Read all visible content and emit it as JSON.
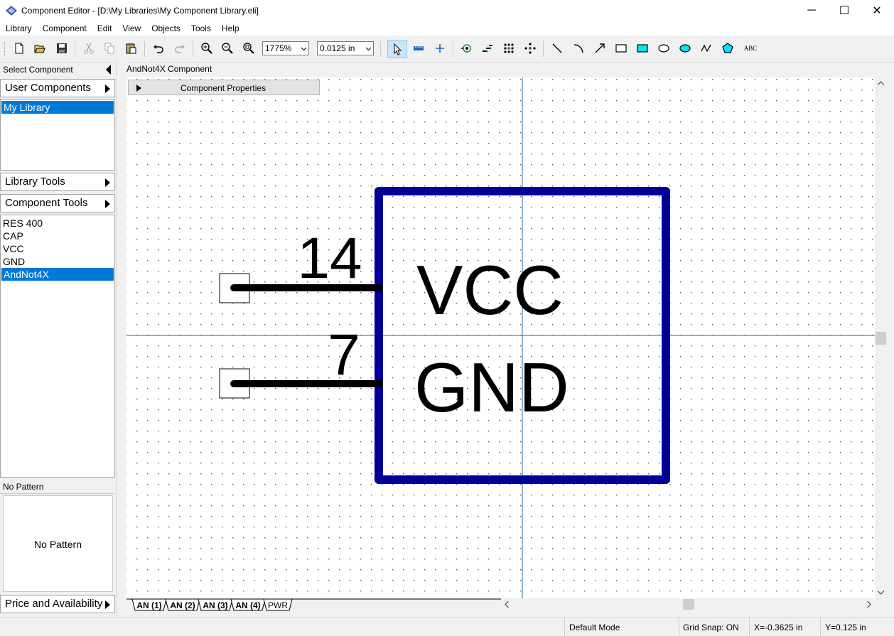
{
  "window": {
    "title": "Component Editor - [D:\\My Libraries\\My Component Library.eli]",
    "minimize": "─",
    "maximize": "☐",
    "close": "✕"
  },
  "menu": [
    "Library",
    "Component",
    "Edit",
    "View",
    "Objects",
    "Tools",
    "Help"
  ],
  "toolbar": {
    "zoom": "1775%",
    "grid": "0.0125 in",
    "text_tool": "ABC"
  },
  "left_panel": {
    "select_component": "Select Component",
    "user_components": "User Components",
    "libraries": [
      "My Library"
    ],
    "library_tools": "Library Tools",
    "component_tools": "Component Tools",
    "components": [
      "RES 400",
      "CAP",
      "VCC",
      "GND",
      "AndNot4X"
    ],
    "selected_component": "AndNot4X",
    "pattern_header": "No Pattern",
    "pattern_preview": "No Pattern",
    "price_availability": "Price and Availability"
  },
  "canvas": {
    "title": "AndNot4X Component",
    "properties_label": "Component Properties",
    "pins": [
      {
        "number": "14",
        "name": "VCC"
      },
      {
        "number": "7",
        "name": "GND"
      }
    ],
    "body_color": "#000099"
  },
  "tabs": [
    "AN (1)",
    "AN (2)",
    "AN (3)",
    "AN (4)",
    "PWR"
  ],
  "active_tab": "PWR",
  "status": {
    "mode": "Default Mode",
    "grid_snap": "Grid Snap: ON",
    "x": "X=-0.3625 in",
    "y": "Y=0.125 in"
  }
}
